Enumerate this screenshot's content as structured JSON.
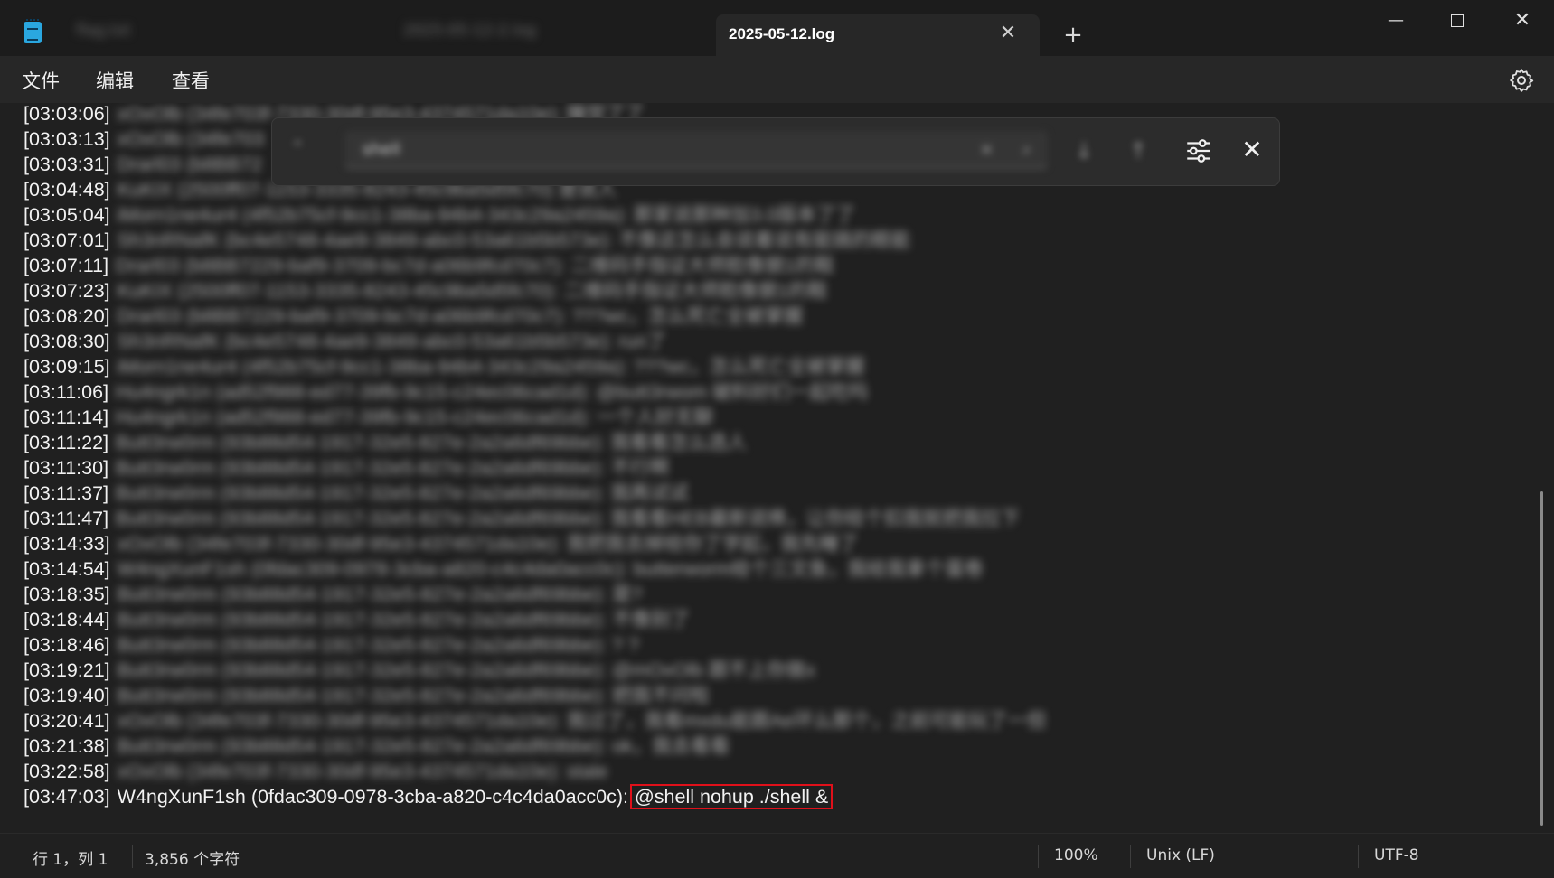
{
  "window": {
    "background_tabs": [
      "flag.txt",
      "2025-05-12-2.log"
    ],
    "active_tab": "2025-05-12.log",
    "new_tab_label": "+",
    "controls": {
      "minimize": "—",
      "close": "✕"
    }
  },
  "menu": {
    "file": "文件",
    "edit": "编辑",
    "view": "查看"
  },
  "editor": {
    "lines": [
      {
        "time": "[03:03:06]",
        "rest": "xOxOlb (34fe703f-7330-30df-95e3-4374571da10e): 睡觉了了"
      },
      {
        "time": "[03:03:13]",
        "rest": "xOxOlb (34fe703"
      },
      {
        "time": "[03:03:31]",
        "rest": "Drarl03 (b8BB72"
      },
      {
        "time": "[03:04:48]",
        "rest": "KuKIX (2500ff07-1153-3335-8243-45c9ba5d5fc70) 是说人"
      },
      {
        "time": "[03:05:04]",
        "rest": "iMorn1ne4ur4 (4f52b75cf-9cc1-38ba-94b4-343c29a2459a): 那家说那种加3.0版本了了"
      },
      {
        "time": "[03:07:01]",
        "rest": "Sh3nRNafK (bc4e5748-4ae9-3849-abc0-53a61b5b573e): 不像这怎么会说着说有能搞的眼能"
      },
      {
        "time": "[03:07:11]",
        "rest": "Drarl03 (b8BB7229-baf9-3709-bc7d-a06b9fcd70c7): 二维码手指证大师脸像貌1的鞋"
      },
      {
        "time": "[03:07:23]",
        "rest": "KuKIX (2500ff07-1153-3335-8243-45c9ba5d5fc70): 二维码手指证大师脸像貌1的鞋"
      },
      {
        "time": "[03:08:20]",
        "rest": "Drarl03 (b8BB7229-baf9-3709-bc7d-a06b9fcd70c7): ???wc，怎么死亡全被掌握"
      },
      {
        "time": "[03:08:30]",
        "rest": "Sh3nRNafK (bc4e5748-4ae9-3849-abc0-53a61b5b573e): run了"
      },
      {
        "time": "[03:09:15]",
        "rest": "iMorn1ne4ur4 (4f52b75cf-9cc1-38ba-94b4-343c29a2459a): ???wc，怎么死亡全被掌握"
      },
      {
        "time": "[03:11:06]",
        "rest": "Hu4ngrk1n (ad52f988-ed77-39fb-9c15-c24ec06cad1d): @butt3rwom 破料好们一起吃吗"
      },
      {
        "time": "[03:11:14]",
        "rest": "Hu4ngrk1n (ad52f988-ed77-39fb-9c15-c24ec06cad1d): 一个人好无聊"
      },
      {
        "time": "[03:11:22]",
        "rest": "Butt3rw0rm (93b88d54-1917-32e5-827e-2a2a6df69bbe): 我看看怎么选人"
      },
      {
        "time": "[03:11:30]",
        "rest": "Butt3rw0rm (93b88d54-1917-32e5-827e-2a2a6df69bbe): 不行啊"
      },
      {
        "time": "[03:11:37]",
        "rest": "Butt3rw0rm (93b88d54-1917-32e5-827e-2a2a6df69bbe): 我再试试"
      },
      {
        "time": "[03:11:47]",
        "rest": "Butt3rw0rm (93b88d54-1917-32e5-827e-2a2a6df69bbe): 我看看HEB最新说唤，让你给个扣我就把我拉下"
      },
      {
        "time": "[03:14:33]",
        "rest": "xOxOlb (34fe703f-7330-30df-95e3-4374571da10e): 我把我去掉给你了学起，我先睡了"
      },
      {
        "time": "[03:14:54]",
        "rest": "W4ngXunF1sh (0fdac309-0978-3cba-a820-c4c4da0acc0c): butterworm给个三文鱼，我给我拿个蛋卷"
      },
      {
        "time": "[03:18:35]",
        "rest": "Butt3rw0rm (93b88d54-1917-32e5-827e-2a2a6df69bbe): 是?"
      },
      {
        "time": "[03:18:44]",
        "rest": "Butt3rw0rm (93b88d54-1917-32e5-827e-2a2a6df69bbe): 不像别了"
      },
      {
        "time": "[03:18:46]",
        "rest": "Butt3rw0rm (93b88d54-1917-32e5-827e-2a2a6df69bbe): ? ?"
      },
      {
        "time": "[03:19:21]",
        "rest": "Butt3rw0rm (93b88d54-1917-32e5-827e-2a2a6df69bbe): @mOxOlb 跟不上你做x"
      },
      {
        "time": "[03:19:40]",
        "rest": "Butt3rw0rm (93b88d54-1917-32e5-827e-2a2a6df69bbe): 把我不问啦"
      },
      {
        "time": "[03:20:41]",
        "rest": "xOxOlb (34fe703f-7330-30df-95e3-4374571da10e): 我过了，我看mxdu能跟Ae环么那个，之前可能玩了一但"
      },
      {
        "time": "[03:21:38]",
        "rest": "Butt3rw0rm (93b88d54-1917-32e5-827e-2a2a6df69bbe): ok，我去看看"
      },
      {
        "time": "[03:22:58]",
        "rest": "xOxOlb (34fe703f-7330-30df-95e3-4374571da10e): stale"
      }
    ],
    "last_line": {
      "time": "[03:47:03]",
      "author": "W4ngXunF1sh (0fdac309-0978-3cba-a820-c4c4da0acc0c):",
      "command": "@shell nohup ./shell &"
    }
  },
  "find": {
    "query": "shell",
    "clear": "×",
    "search_glyph": "⌕",
    "prev_glyph": "⌃",
    "down_glyph": "↓",
    "up_glyph": "↑",
    "close_glyph": "✕"
  },
  "status": {
    "position": "行 1，列 1",
    "chars": "3,856 个字符",
    "zoom": "100%",
    "line_ending": "Unix (LF)",
    "encoding": "UTF-8"
  },
  "colors": {
    "highlight_border": "#e0101a",
    "app_icon": "#2aa7e0",
    "background": "#202020"
  }
}
